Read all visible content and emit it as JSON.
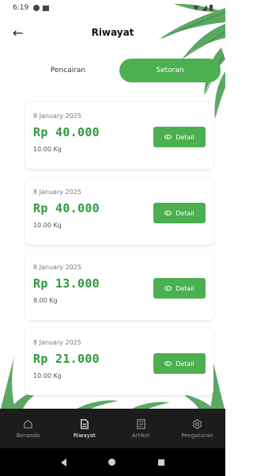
{
  "status_bar": {
    "time": "6:19"
  },
  "header": {
    "back_label": "←",
    "title": "Riwayat"
  },
  "tabs": [
    {
      "label": "Pencairan",
      "active": false
    },
    {
      "label": "Setoran",
      "active": true
    }
  ],
  "records": [
    {
      "date": "8 January 2025",
      "amount": "Rp 40.000",
      "weight": "10.00 Kg",
      "button": "Detail"
    },
    {
      "date": "8 January 2025",
      "amount": "Rp 40.000",
      "weight": "10.00 Kg",
      "button": "Detail"
    },
    {
      "date": "8 January 2025",
      "amount": "Rp 13.000",
      "weight": "8.00 Kg",
      "button": "Detail"
    },
    {
      "date": "8 January 2025",
      "amount": "Rp 21.000",
      "weight": "10.00 Kg",
      "button": "Detail"
    }
  ],
  "bottom_nav": [
    {
      "label": "Beranda",
      "icon": "home-icon",
      "active": false
    },
    {
      "label": "Riwayat",
      "icon": "document-icon",
      "active": true
    },
    {
      "label": "Artikel",
      "icon": "article-icon",
      "active": false
    },
    {
      "label": "Pengaturan",
      "icon": "settings-icon",
      "active": false
    }
  ],
  "colors": {
    "accent": "#4caf50",
    "amount": "#2e9a3e",
    "nav_bg": "#1c1c1c"
  }
}
